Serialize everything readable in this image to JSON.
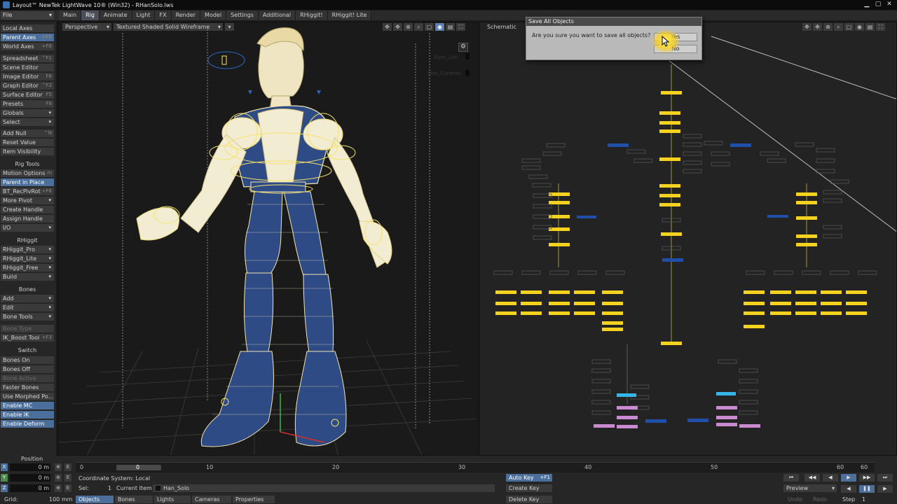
{
  "window": {
    "title": "Layout™ NewTek LightWave 10® (Win32) - RHanSolo.lws",
    "min_glyph": "▁",
    "max_glyph": "▢",
    "close_glyph": "✕"
  },
  "menubar": {
    "file_label": "File",
    "tabs": [
      {
        "label": "Main"
      },
      {
        "label": "Rig"
      },
      {
        "label": "Animate"
      },
      {
        "label": "Light"
      },
      {
        "label": "FX"
      },
      {
        "label": "Render"
      },
      {
        "label": "Model"
      },
      {
        "label": "Settings"
      },
      {
        "label": "Additional"
      },
      {
        "label": "RHiggit!"
      },
      {
        "label": "RHiggit! Lite"
      }
    ],
    "active_tab": "Rig"
  },
  "leftpanel": {
    "items": [
      {
        "label": "Local Axes",
        "shortcut": "",
        "dd": false,
        "hl": false,
        "dim": false
      },
      {
        "label": "Parent Axes",
        "shortcut": "+F6",
        "dd": false,
        "hl": true,
        "dim": false
      },
      {
        "label": "World Axes",
        "shortcut": "+F8",
        "dd": false,
        "hl": false,
        "dim": false
      },
      {
        "label": "Spreadsheet",
        "shortcut": "^F1",
        "dd": false,
        "hl": false,
        "dim": false
      },
      {
        "label": "Scene Editor",
        "shortcut": "",
        "dd": false,
        "hl": false,
        "dim": false
      },
      {
        "label": "Image Editor",
        "shortcut": "F6",
        "dd": false,
        "hl": false,
        "dim": false
      },
      {
        "label": "Graph Editor",
        "shortcut": "^F2",
        "dd": false,
        "hl": false,
        "dim": false
      },
      {
        "label": "Surface Editor",
        "shortcut": "F5",
        "dd": false,
        "hl": false,
        "dim": false
      },
      {
        "label": "Presets",
        "shortcut": "F8",
        "dd": false,
        "hl": false,
        "dim": false
      },
      {
        "label": "Globals",
        "shortcut": "",
        "dd": true,
        "hl": false,
        "dim": false
      },
      {
        "label": "Select",
        "shortcut": "",
        "dd": true,
        "hl": false,
        "dim": false
      },
      {
        "label": "Add Null",
        "shortcut": "^N",
        "dd": false,
        "hl": false,
        "dim": false
      },
      {
        "label": "Reset Value",
        "shortcut": "",
        "dd": false,
        "hl": false,
        "dim": false
      },
      {
        "label": "Item Visibility",
        "shortcut": "",
        "dd": false,
        "hl": false,
        "dim": false
      },
      {
        "label": "Motion Options",
        "shortcut": "m",
        "dd": false,
        "hl": false,
        "dim": false
      },
      {
        "label": "Parent in Place",
        "shortcut": "",
        "dd": false,
        "hl": true,
        "dim": false
      },
      {
        "label": "BT_RecPivRot",
        "shortcut": "+F6",
        "dd": false,
        "hl": false,
        "dim": false
      },
      {
        "label": "More Pivot",
        "shortcut": "",
        "dd": true,
        "hl": false,
        "dim": false
      },
      {
        "label": "Create Handle",
        "shortcut": "",
        "dd": false,
        "hl": false,
        "dim": false
      },
      {
        "label": "Assign Handle",
        "shortcut": "",
        "dd": false,
        "hl": false,
        "dim": false
      },
      {
        "label": "I/O",
        "shortcut": "",
        "dd": true,
        "hl": false,
        "dim": false
      },
      {
        "label": "RHiggit_Pro",
        "shortcut": "",
        "dd": true,
        "hl": false,
        "dim": false
      },
      {
        "label": "RHiggit_Lite",
        "shortcut": "",
        "dd": true,
        "hl": false,
        "dim": false
      },
      {
        "label": "RHiggit_Free",
        "shortcut": "",
        "dd": true,
        "hl": false,
        "dim": false
      },
      {
        "label": "Build",
        "shortcut": "",
        "dd": true,
        "hl": false,
        "dim": false
      },
      {
        "label": "Add",
        "shortcut": "",
        "dd": true,
        "hl": false,
        "dim": false
      },
      {
        "label": "Edit",
        "shortcut": "",
        "dd": true,
        "hl": false,
        "dim": false
      },
      {
        "label": "Bone Tools",
        "shortcut": "",
        "dd": true,
        "hl": false,
        "dim": false
      },
      {
        "label": "Bone Type",
        "shortcut": "",
        "dd": false,
        "hl": false,
        "dim": true
      },
      {
        "label": "IK_Boost Tool",
        "shortcut": "+F3",
        "dd": false,
        "hl": false,
        "dim": false
      },
      {
        "label": "Bones On",
        "shortcut": "",
        "dd": false,
        "hl": false,
        "dim": false
      },
      {
        "label": "Bones Off",
        "shortcut": "",
        "dd": false,
        "hl": false,
        "dim": false
      },
      {
        "label": "Bone Active",
        "shortcut": "",
        "dd": false,
        "hl": false,
        "dim": true
      },
      {
        "label": "Faster Bones",
        "shortcut": "",
        "dd": false,
        "hl": false,
        "dim": false
      },
      {
        "label": "Use Morphed Po...",
        "shortcut": "",
        "dd": false,
        "hl": false,
        "dim": false
      },
      {
        "label": "Enable MC",
        "shortcut": "",
        "dd": false,
        "hl": true,
        "dim": false
      },
      {
        "label": "Enable IK",
        "shortcut": "",
        "dd": false,
        "hl": true,
        "dim": false
      },
      {
        "label": "Enable Deform",
        "shortcut": "",
        "dd": false,
        "hl": true,
        "dim": false
      }
    ],
    "headings": [
      "Rig Tools",
      "RHiggit",
      "Bones",
      "Switch"
    ]
  },
  "viewport_left": {
    "view_label": "Perspective",
    "shading_label": "Textured Shaded Solid Wireframe"
  },
  "viewport_right": {
    "view_label": "Schematic",
    "node_labels": [
      "Eyes_LAn",
      "Side_Controls"
    ]
  },
  "dialog": {
    "title": "Save All Objects",
    "message": "Are you sure you want to save all objects?",
    "yes_label": "Yes",
    "no_label": "No"
  },
  "bottom": {
    "position_label": "Position",
    "axes": [
      {
        "tag": "X",
        "value": "0 m",
        "color": "#4b6f9a"
      },
      {
        "tag": "Y",
        "value": "0 m",
        "color": "#4b8a4b"
      },
      {
        "tag": "Z",
        "value": "0 m",
        "color": "#4b6f9a"
      }
    ],
    "grid_label": "Grid:",
    "grid_value": "100 mm",
    "timeline_ticks": [
      "0",
      "10",
      "20",
      "30",
      "40",
      "50",
      "60"
    ],
    "timeline_end": "60",
    "current_frame": "0",
    "coord_system": "Coordinate System: Local",
    "sel_label": "Sel:",
    "sel_value": "1",
    "current_item_label": "Current Item",
    "current_item_value": "Han_Solo",
    "item_tabs": [
      "Objects",
      "Bones",
      "Lights",
      "Cameras",
      "Properties"
    ],
    "auto_key": "Auto Key",
    "auto_key_shortcut": "+F1",
    "create_key": "Create Key",
    "delete_key": "Delete Key",
    "preview": "Preview",
    "step_label": "Step",
    "step_value": "1"
  },
  "colors": {
    "accent": "#4b6f9a",
    "wire_yellow": "#f4e36a",
    "wire_blue": "#2f63b8",
    "node_yellow": "#f5d21d",
    "node_blue": "#1f4fa8",
    "node_cyan": "#35b6e6",
    "node_pink": "#c98ad0"
  }
}
